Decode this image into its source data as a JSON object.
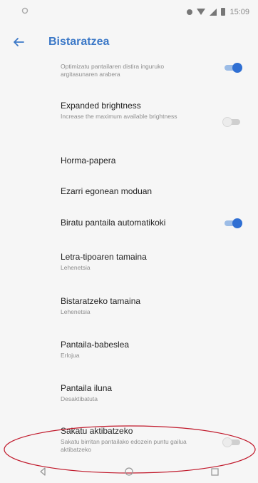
{
  "status_bar": {
    "time": "15:09",
    "icons": [
      "notification-icon",
      "wifi-icon",
      "signal-icon",
      "battery-icon"
    ]
  },
  "app_bar": {
    "title": "Bistaratzea",
    "back_icon": "arrow-left-icon"
  },
  "colors": {
    "accent": "#3b78c7",
    "toggle_on": "#2f6fd3",
    "annotation": "#c0182a",
    "background": "#f6f6f6"
  },
  "items": [
    {
      "title": "",
      "subtitle": "Optimizatu pantailaren distira inguruko argitasunaren arabera",
      "toggle": "on"
    },
    {
      "title": "Expanded brightness",
      "subtitle": "Increase the maximum available brightness",
      "toggle": "off"
    },
    {
      "title": "Horma-papera",
      "subtitle": ""
    },
    {
      "title": "Ezarri egonean moduan",
      "subtitle": ""
    },
    {
      "title": "Biratu pantaila automatikoki",
      "subtitle": "",
      "toggle": "on"
    },
    {
      "title": "Letra-tipoaren tamaina",
      "subtitle": "Lehenetsia"
    },
    {
      "title": "Bistaratzeko tamaina",
      "subtitle": "Lehenetsia"
    },
    {
      "title": "Pantaila-babeslea",
      "subtitle": "Erlojua"
    },
    {
      "title": "Pantaila iluna",
      "subtitle": "Desaktibatuta"
    },
    {
      "title": "Sakatu aktibatzeko",
      "subtitle": "Sakatu birritan pantailako edozein puntu gailua aktibatzeko",
      "toggle": "off"
    }
  ],
  "nav_bar": {
    "icons": [
      "back-triangle-icon",
      "home-circle-icon",
      "recents-square-icon"
    ]
  }
}
